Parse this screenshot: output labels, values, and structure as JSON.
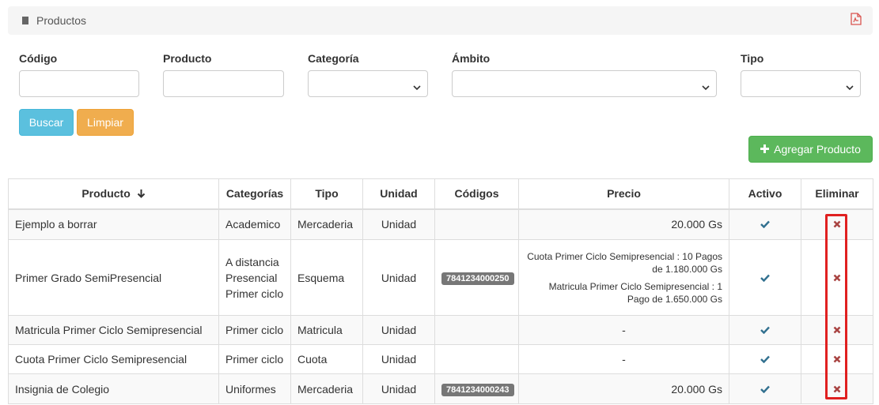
{
  "header": {
    "title": "Productos",
    "icons": [
      "book-icon",
      "pdf-icon"
    ]
  },
  "filters": {
    "codigo_label": "Código",
    "producto_label": "Producto",
    "categoria_label": "Categoría",
    "ambito_label": "Ámbito",
    "tipo_label": "Tipo"
  },
  "buttons": {
    "buscar": "Buscar",
    "limpiar": "Limpiar",
    "agregar": "Agregar Producto"
  },
  "table": {
    "headers": [
      "Producto",
      "Categorías",
      "Tipo",
      "Unidad",
      "Códigos",
      "Precio",
      "Activo",
      "Eliminar"
    ],
    "rows": [
      {
        "producto": "Ejemplo a borrar",
        "categorias": [
          "Academico"
        ],
        "tipo": "Mercaderia",
        "unidad": "Unidad",
        "codigo": "",
        "precio": [
          "20.000 Gs"
        ]
      },
      {
        "producto": "Primer Grado SemiPresencial",
        "categorias": [
          "A distancia",
          "Presencial",
          "Primer ciclo"
        ],
        "tipo": "Esquema",
        "unidad": "Unidad",
        "codigo": "7841234000250",
        "precio": [
          [
            "Cuota Primer Ciclo Semipresencial : 10 Pagos",
            "de 1.180.000 Gs"
          ],
          [
            "Matricula Primer Ciclo Semipresencial : 1",
            "Pago de 1.650.000 Gs"
          ]
        ]
      },
      {
        "producto": "Matricula Primer Ciclo Semipresencial",
        "categorias": [
          "Primer ciclo"
        ],
        "tipo": "Matricula",
        "unidad": "Unidad",
        "codigo": "",
        "precio": [
          "-"
        ]
      },
      {
        "producto": "Cuota Primer Ciclo Semipresencial",
        "categorias": [
          "Primer ciclo"
        ],
        "tipo": "Cuota",
        "unidad": "Unidad",
        "codigo": "",
        "precio": [
          "-"
        ]
      },
      {
        "producto": "Insignia de Colegio",
        "categorias": [
          "Uniformes"
        ],
        "tipo": "Mercaderia",
        "unidad": "Unidad",
        "codigo": "7841234000243",
        "precio": [
          "20.000 Gs"
        ]
      }
    ]
  },
  "colors": {
    "buscar": "#5bc0de",
    "limpiar": "#f0ad4e",
    "agregar": "#5cb85c",
    "check": "#31708f",
    "delete": "#a94442",
    "highlight": "#e02020"
  }
}
